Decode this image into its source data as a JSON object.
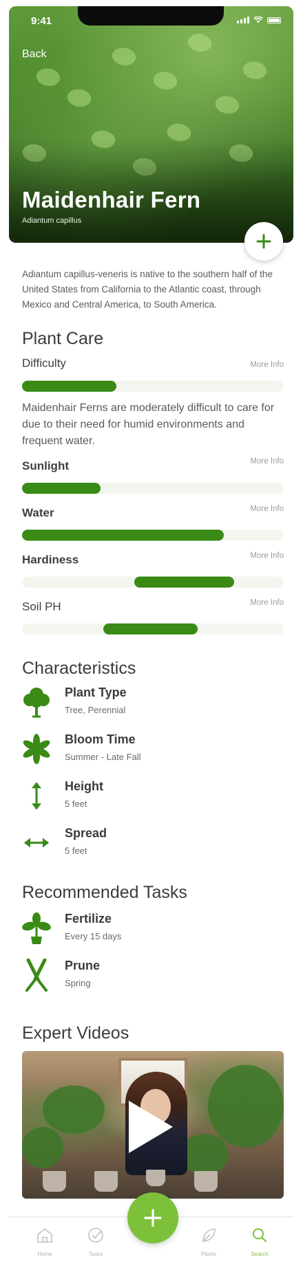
{
  "status_bar": {
    "time": "9:41"
  },
  "header": {
    "back_label": "Back",
    "title": "Maidenhair Fern",
    "subtitle": "Adiantum capillus"
  },
  "description": "Adiantum capillus-veneris is native to the southern half of the United States from California to the Atlantic coast, through Mexico and Central America, to South America.",
  "plant_care": {
    "title": "Plant Care",
    "more_info_label": "More Info",
    "difficulty": {
      "label": "Difficulty",
      "level": 0.36,
      "note": "Maidenhair Ferns are moderately difficult to care for due to their need for humid environments and frequent water."
    },
    "sunlight": {
      "label": "Sunlight",
      "level": 0.3
    },
    "water": {
      "label": "Water",
      "level": 0.77
    },
    "hardiness": {
      "label": "Hardiness",
      "range": [
        0.43,
        0.81
      ]
    },
    "soil_ph": {
      "label": "Soil PH",
      "range": [
        0.31,
        0.67
      ]
    }
  },
  "characteristics": {
    "title": "Characteristics",
    "items": [
      {
        "icon": "tree-icon",
        "title": "Plant Type",
        "value": "Tree, Perennial"
      },
      {
        "icon": "flower-icon",
        "title": "Bloom Time",
        "value": "Summer - Late Fall"
      },
      {
        "icon": "vertical-arrow-icon",
        "title": "Height",
        "value": "5 feet"
      },
      {
        "icon": "horizontal-arrow-icon",
        "title": "Spread",
        "value": "5 feet"
      }
    ]
  },
  "recommended_tasks": {
    "title": "Recommended Tasks",
    "items": [
      {
        "icon": "sprout-pot-icon",
        "title": "Fertilize",
        "value": "Every 15 days"
      },
      {
        "icon": "pruning-shears-icon",
        "title": "Prune",
        "value": "Spring"
      }
    ]
  },
  "expert_videos": {
    "title": "Expert Videos"
  },
  "tab_bar": {
    "items": [
      {
        "label": "Home",
        "icon": "home-icon"
      },
      {
        "label": "Tasks",
        "icon": "check-circle-icon"
      },
      {
        "label": "Plants",
        "icon": "leaf-icon"
      },
      {
        "label": "Search",
        "icon": "search-icon"
      }
    ],
    "active": "Search"
  },
  "colors": {
    "accent_green": "#3a8a16",
    "fab_green": "#7dc13a",
    "active_tab": "#7cc23a",
    "track_bg": "#f3f6ee"
  }
}
